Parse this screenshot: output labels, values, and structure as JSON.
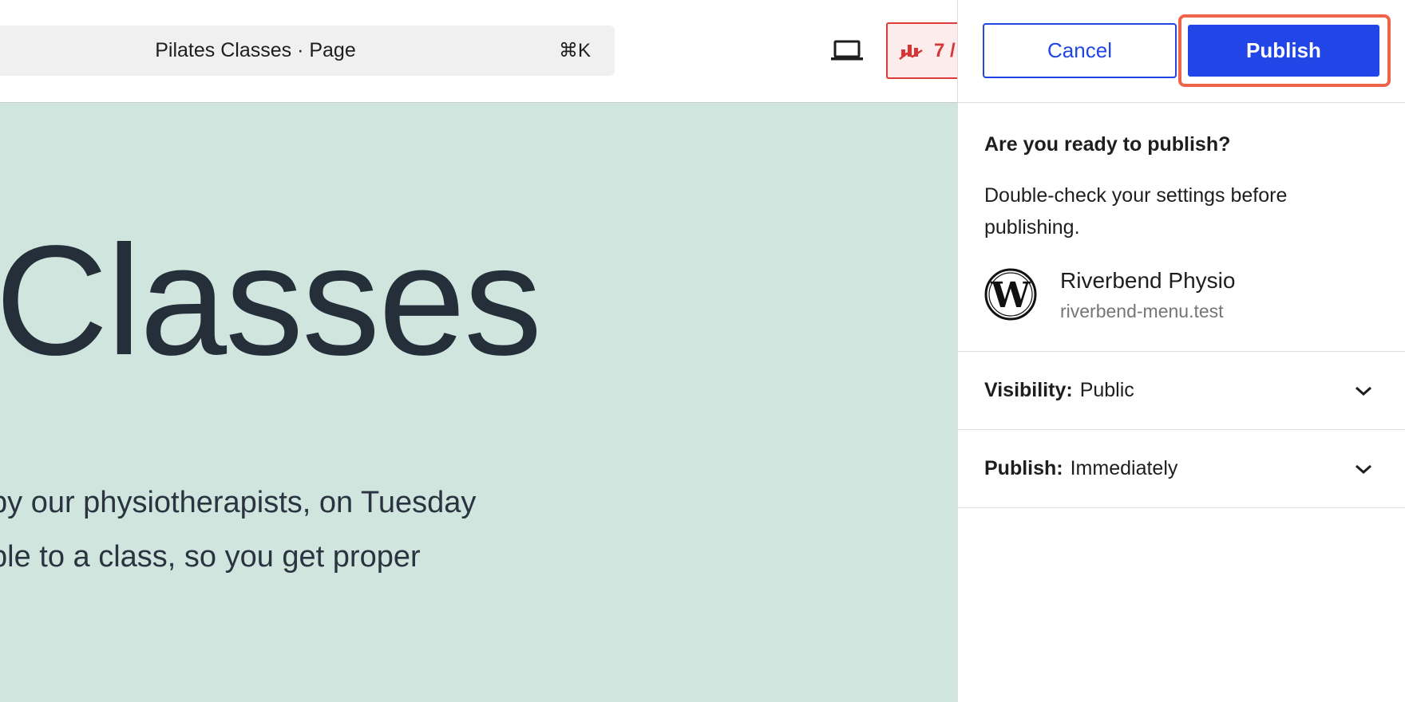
{
  "topbar": {
    "command_title": "Pilates Classes · Page",
    "command_shortcut": "⌘K",
    "device_icon": "laptop-icon",
    "audit_icon": "chart-alert-icon",
    "audit_count": "7 /"
  },
  "canvas": {
    "heading": "Classes",
    "body_line_1": "by our physiotherapists, on Tuesday",
    "body_line_2": "ble to a class, so you get proper"
  },
  "panel": {
    "cancel_label": "Cancel",
    "publish_label": "Publish",
    "ready_title": "Are you ready to publish?",
    "ready_description": "Double-check your settings before publishing.",
    "site": {
      "logo_icon": "wordpress-logo-icon",
      "name": "Riverbend Physio",
      "url": "riverbend-menu.test"
    },
    "visibility": {
      "label": "Visibility:",
      "value": "Public"
    },
    "publish_time": {
      "label": "Publish:",
      "value": "Immediately"
    }
  },
  "colors": {
    "accent": "#2145e6",
    "highlight": "#f0634a",
    "canvas_bg": "#d1e5df",
    "audit_red": "#d63638"
  }
}
